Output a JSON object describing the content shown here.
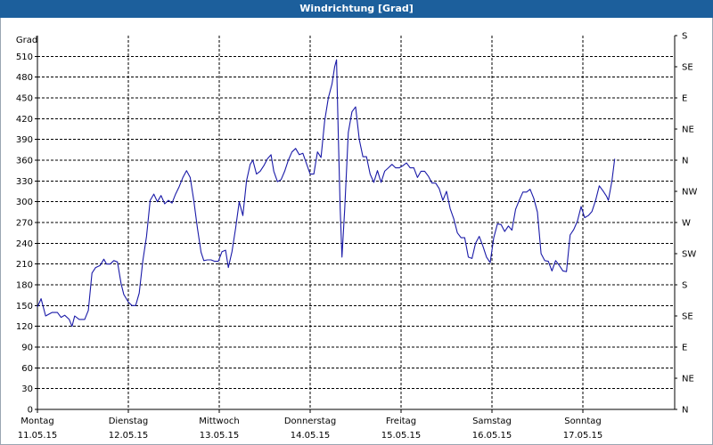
{
  "chart_data": {
    "type": "line",
    "title": "Windrichtung [Grad]",
    "ylabel": "Grad",
    "ylim": [
      0,
      540
    ],
    "y_ticks": [
      0,
      30,
      60,
      90,
      120,
      150,
      180,
      210,
      240,
      270,
      300,
      330,
      360,
      390,
      420,
      450,
      480,
      510
    ],
    "y2_ticks": [
      "N",
      "NE",
      "E",
      "SE",
      "S",
      "SW",
      "W",
      "NW",
      "N",
      "NE",
      "E",
      "SE",
      "S"
    ],
    "xlim": [
      0,
      7
    ],
    "x_ticks": [
      {
        "day": "Montag",
        "date": "11.05.15"
      },
      {
        "day": "Dienstag",
        "date": "12.05.15"
      },
      {
        "day": "Mittwoch",
        "date": "13.05.15"
      },
      {
        "day": "Donnerstag",
        "date": "14.05.15"
      },
      {
        "day": "Freitag",
        "date": "15.05.15"
      },
      {
        "day": "Samstag",
        "date": "16.05.15"
      },
      {
        "day": "Sonntag",
        "date": "17.05.15"
      }
    ],
    "grid": true,
    "series": [
      {
        "color": "#1a1aa8",
        "points": [
          [
            0.0,
            148
          ],
          [
            0.04,
            160
          ],
          [
            0.09,
            135
          ],
          [
            0.16,
            140
          ],
          [
            0.22,
            140
          ],
          [
            0.26,
            133
          ],
          [
            0.3,
            136
          ],
          [
            0.35,
            130
          ],
          [
            0.38,
            120
          ],
          [
            0.41,
            135
          ],
          [
            0.46,
            130
          ],
          [
            0.52,
            130
          ],
          [
            0.56,
            143
          ],
          [
            0.6,
            197
          ],
          [
            0.64,
            205
          ],
          [
            0.69,
            208
          ],
          [
            0.73,
            217
          ],
          [
            0.76,
            210
          ],
          [
            0.8,
            210
          ],
          [
            0.84,
            215
          ],
          [
            0.88,
            213
          ],
          [
            0.92,
            182
          ],
          [
            0.95,
            166
          ],
          [
            1.0,
            155
          ],
          [
            1.04,
            150
          ],
          [
            1.08,
            150
          ],
          [
            1.12,
            168
          ],
          [
            1.16,
            215
          ],
          [
            1.2,
            250
          ],
          [
            1.24,
            302
          ],
          [
            1.28,
            311
          ],
          [
            1.32,
            300
          ],
          [
            1.36,
            309
          ],
          [
            1.4,
            297
          ],
          [
            1.44,
            302
          ],
          [
            1.48,
            298
          ],
          [
            1.52,
            311
          ],
          [
            1.56,
            322
          ],
          [
            1.6,
            335
          ],
          [
            1.64,
            345
          ],
          [
            1.68,
            335
          ],
          [
            1.72,
            302
          ],
          [
            1.76,
            262
          ],
          [
            1.8,
            227
          ],
          [
            1.83,
            215
          ],
          [
            1.87,
            216
          ],
          [
            1.91,
            216
          ],
          [
            1.95,
            214
          ],
          [
            1.99,
            214
          ],
          [
            2.03,
            228
          ],
          [
            2.07,
            230
          ],
          [
            2.1,
            205
          ],
          [
            2.14,
            228
          ],
          [
            2.18,
            262
          ],
          [
            2.22,
            300
          ],
          [
            2.26,
            280
          ],
          [
            2.3,
            330
          ],
          [
            2.34,
            354
          ],
          [
            2.37,
            360
          ],
          [
            2.41,
            340
          ],
          [
            2.45,
            344
          ],
          [
            2.49,
            352
          ],
          [
            2.53,
            362
          ],
          [
            2.57,
            368
          ],
          [
            2.6,
            344
          ],
          [
            2.64,
            329
          ],
          [
            2.68,
            332
          ],
          [
            2.72,
            344
          ],
          [
            2.76,
            360
          ],
          [
            2.8,
            372
          ],
          [
            2.84,
            377
          ],
          [
            2.88,
            368
          ],
          [
            2.92,
            370
          ],
          [
            2.96,
            355
          ],
          [
            3.0,
            340
          ],
          [
            3.04,
            340
          ],
          [
            3.08,
            372
          ],
          [
            3.12,
            364
          ],
          [
            3.16,
            417
          ],
          [
            3.2,
            450
          ],
          [
            3.24,
            470
          ],
          [
            3.27,
            495
          ],
          [
            3.29,
            505
          ],
          [
            3.31,
            395
          ],
          [
            3.33,
            290
          ],
          [
            3.35,
            220
          ],
          [
            3.38,
            290
          ],
          [
            3.42,
            400
          ],
          [
            3.46,
            430
          ],
          [
            3.5,
            437
          ],
          [
            3.54,
            390
          ],
          [
            3.58,
            365
          ],
          [
            3.62,
            365
          ],
          [
            3.66,
            340
          ],
          [
            3.7,
            328
          ],
          [
            3.74,
            345
          ],
          [
            3.78,
            328
          ],
          [
            3.82,
            344
          ],
          [
            3.86,
            349
          ],
          [
            3.9,
            354
          ],
          [
            3.94,
            349
          ],
          [
            3.98,
            349
          ],
          [
            4.02,
            352
          ],
          [
            4.06,
            356
          ],
          [
            4.1,
            349
          ],
          [
            4.14,
            349
          ],
          [
            4.18,
            335
          ],
          [
            4.22,
            344
          ],
          [
            4.26,
            344
          ],
          [
            4.3,
            337
          ],
          [
            4.34,
            327
          ],
          [
            4.38,
            327
          ],
          [
            4.42,
            319
          ],
          [
            4.46,
            302
          ],
          [
            4.5,
            315
          ],
          [
            4.54,
            290
          ],
          [
            4.58,
            275
          ],
          [
            4.62,
            255
          ],
          [
            4.66,
            248
          ],
          [
            4.7,
            248
          ],
          [
            4.74,
            220
          ],
          [
            4.78,
            218
          ],
          [
            4.82,
            240
          ],
          [
            4.86,
            250
          ],
          [
            4.9,
            236
          ],
          [
            4.94,
            220
          ],
          [
            4.98,
            212
          ],
          [
            5.02,
            248
          ],
          [
            5.06,
            268
          ],
          [
            5.1,
            267
          ],
          [
            5.14,
            257
          ],
          [
            5.18,
            265
          ],
          [
            5.22,
            259
          ],
          [
            5.26,
            289
          ],
          [
            5.3,
            302
          ],
          [
            5.34,
            314
          ],
          [
            5.38,
            314
          ],
          [
            5.42,
            318
          ],
          [
            5.46,
            305
          ],
          [
            5.5,
            285
          ],
          [
            5.54,
            225
          ],
          [
            5.58,
            215
          ],
          [
            5.62,
            214
          ],
          [
            5.66,
            200
          ],
          [
            5.7,
            215
          ],
          [
            5.74,
            208
          ],
          [
            5.78,
            200
          ],
          [
            5.82,
            199
          ],
          [
            5.86,
            252
          ],
          [
            5.9,
            260
          ],
          [
            5.94,
            272
          ],
          [
            5.98,
            293
          ],
          [
            6.02,
            277
          ],
          [
            6.06,
            280
          ],
          [
            6.1,
            286
          ],
          [
            6.14,
            302
          ],
          [
            6.18,
            323
          ],
          [
            6.22,
            316
          ],
          [
            6.26,
            308
          ],
          [
            6.28,
            302
          ],
          [
            6.32,
            330
          ],
          [
            6.35,
            362
          ]
        ]
      }
    ]
  }
}
